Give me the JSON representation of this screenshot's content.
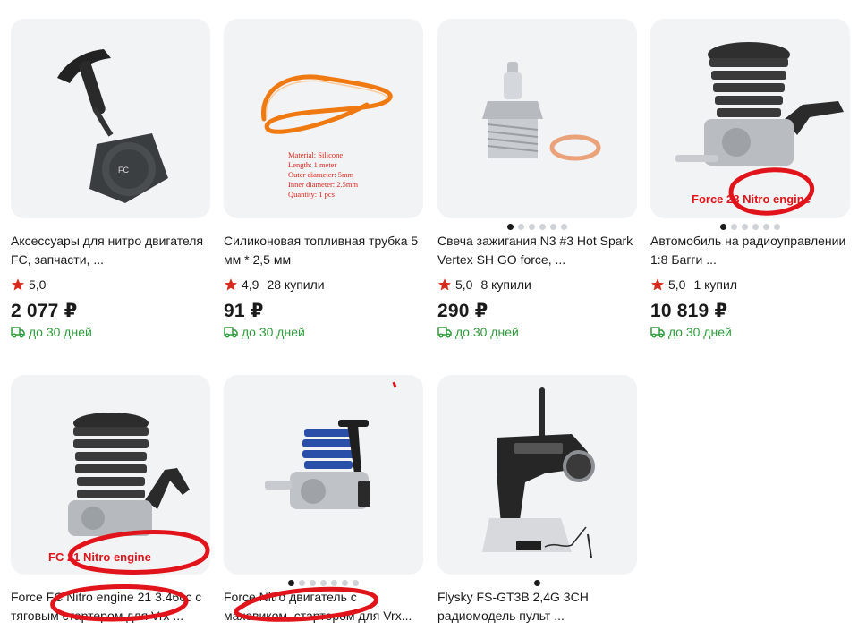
{
  "colors": {
    "card_bg": "#f2f3f5",
    "star": "#d9291c",
    "delivery": "#2c9c3a",
    "text": "#1a1a1a",
    "annotation": "#e0141a"
  },
  "products": [
    {
      "title": "Аксессуары для нитро двигателя FC, запчасти, ...",
      "rating": "5,0",
      "bought": "",
      "price": "2 077 ₽",
      "delivery": "до 30 дней",
      "dots": 0,
      "active_dot": 0,
      "image_icon": "pull-starter-icon"
    },
    {
      "title": "Силиконовая топливная трубка 5 мм * 2,5 мм",
      "rating": "4,9",
      "bought": "28 купили",
      "price": "91 ₽",
      "delivery": "до 30 дней",
      "dots": 0,
      "active_dot": 0,
      "image_icon": "fuel-tube-icon",
      "image_text": {
        "material": "Material: Silicone",
        "length": "Length: 1 meter",
        "outer": "Outer diameter: 5mm",
        "inner": "Inner diameter: 2.5mm",
        "quantity": "Quantity: 1 pcs"
      }
    },
    {
      "title": "Свеча зажигания N3 #3 Hot Spark Vertex SH GO force, ...",
      "rating": "5,0",
      "bought": "8 купили",
      "price": "290 ₽",
      "delivery": "до 30 дней",
      "dots": 6,
      "active_dot": 0,
      "image_icon": "glow-plug-icon"
    },
    {
      "title": "Автомобиль на радиоуправлении 1:8 Багги ...",
      "rating": "5,0",
      "bought": "1 купил",
      "price": "10 819 ₽",
      "delivery": "до 30 дней",
      "dots": 6,
      "active_dot": 0,
      "image_icon": "nitro-engine-icon",
      "image_caption": "Force 28 Nitro engine"
    },
    {
      "title": "Force FC Nitro engine 21 3.46cc с тяговым стартером для Vrx ...",
      "price": "",
      "dots": 0,
      "active_dot": 0,
      "image_icon": "nitro-engine-icon",
      "image_caption": "FC 21 Nitro engine"
    },
    {
      "title": "Force Nitro двигатель с маховиком, стартером для Vrx...",
      "price": "",
      "dots": 7,
      "active_dot": 0,
      "image_icon": "blue-nitro-engine-icon"
    },
    {
      "title": "Flysky FS-GT3B 2,4G 3CH радиомодель пульт ...",
      "price": "",
      "dots": 0,
      "active_dot": 0,
      "image_icon": "radio-transmitter-icon"
    }
  ]
}
